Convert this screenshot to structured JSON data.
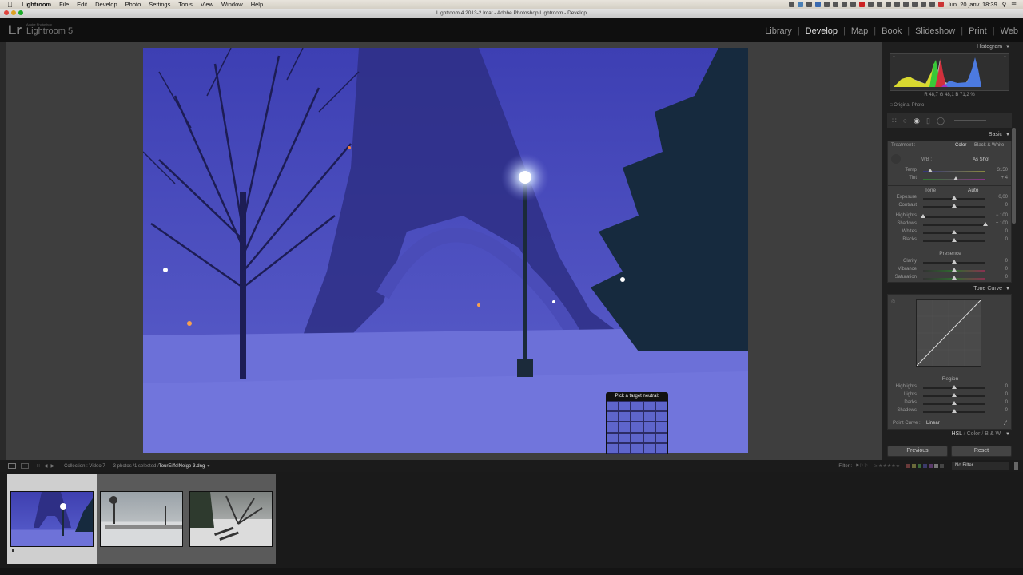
{
  "mac_menubar": {
    "app": "Lightroom",
    "items": [
      "File",
      "Edit",
      "Develop",
      "Photo",
      "Settings",
      "Tools",
      "View",
      "Window",
      "Help"
    ],
    "clock": "lun. 20 janv.  18:39"
  },
  "window": {
    "title": "Lightroom 4 2013-2.lrcat - Adobe Photoshop Lightroom - Develop"
  },
  "identity": {
    "logo": "Lr",
    "sub": "Adobe Photoshop",
    "name": "Lightroom 5"
  },
  "modules": [
    {
      "label": "Library",
      "active": false
    },
    {
      "label": "Develop",
      "active": true
    },
    {
      "label": "Map",
      "active": false
    },
    {
      "label": "Book",
      "active": false
    },
    {
      "label": "Slideshow",
      "active": false
    },
    {
      "label": "Print",
      "active": false
    },
    {
      "label": "Web",
      "active": false
    }
  ],
  "loupe": {
    "title": "Pick a target neutral:",
    "readout": "R 48,7  G 48,1  B 71,2 %"
  },
  "histogram": {
    "title": "Histogram",
    "readout": "R  48,7  G  48,1  B  71,2 %",
    "original_photo": "Original Photo"
  },
  "basic": {
    "title": "Basic",
    "treatment_label": "Treatment :",
    "treatment_color": "Color",
    "treatment_bw": "Black & White",
    "wb_label": "WB :",
    "wb_value": "As Shot",
    "tone_label": "Tone",
    "auto_label": "Auto",
    "presence_label": "Presence",
    "sliders": {
      "temp": {
        "label": "Temp",
        "value": "3150",
        "pos": 0.12
      },
      "tint": {
        "label": "Tint",
        "value": "+ 4",
        "pos": 0.52
      },
      "exposure": {
        "label": "Exposure",
        "value": "0,00",
        "pos": 0.5
      },
      "contrast": {
        "label": "Contrast",
        "value": "0",
        "pos": 0.5
      },
      "highlights": {
        "label": "Highlights",
        "value": "− 100",
        "pos": 0.0
      },
      "shadows": {
        "label": "Shadows",
        "value": "+ 100",
        "pos": 1.0
      },
      "whites": {
        "label": "Whites",
        "value": "0",
        "pos": 0.5
      },
      "blacks": {
        "label": "Blacks",
        "value": "0",
        "pos": 0.5
      },
      "clarity": {
        "label": "Clarity",
        "value": "0",
        "pos": 0.5
      },
      "vibrance": {
        "label": "Vibrance",
        "value": "0",
        "pos": 0.5
      },
      "saturation": {
        "label": "Saturation",
        "value": "0",
        "pos": 0.5
      }
    }
  },
  "tone_curve": {
    "title": "Tone Curve",
    "region_label": "Region",
    "sliders": {
      "highlights": {
        "label": "Highlights",
        "value": "0",
        "pos": 0.5
      },
      "lights": {
        "label": "Lights",
        "value": "0",
        "pos": 0.5
      },
      "darks": {
        "label": "Darks",
        "value": "0",
        "pos": 0.5
      },
      "shadows": {
        "label": "Shadows",
        "value": "0",
        "pos": 0.5
      }
    },
    "point_curve_label": "Point Curve :",
    "point_curve_value": "Linear"
  },
  "hsl": {
    "hsl": "HSL",
    "color": "Color",
    "bw": "B & W",
    "sep": "/"
  },
  "buttons": {
    "previous": "Previous",
    "reset": "Reset"
  },
  "filmstrip_bar": {
    "collection": "Collection : Video 7",
    "count": "3 photos /1 selected /",
    "filename": "TourEiffelNeige-3.dng",
    "filter_label": "Filter :",
    "filter_value": "No Filter"
  },
  "filmstrip": [
    {
      "name": "eiffel-snow",
      "selected": true
    },
    {
      "name": "bridge-snow",
      "selected": false
    },
    {
      "name": "bench-snow",
      "selected": false
    }
  ],
  "colors": {
    "photo_blue": "#4848b6",
    "active_module": "#e0e0e0"
  }
}
